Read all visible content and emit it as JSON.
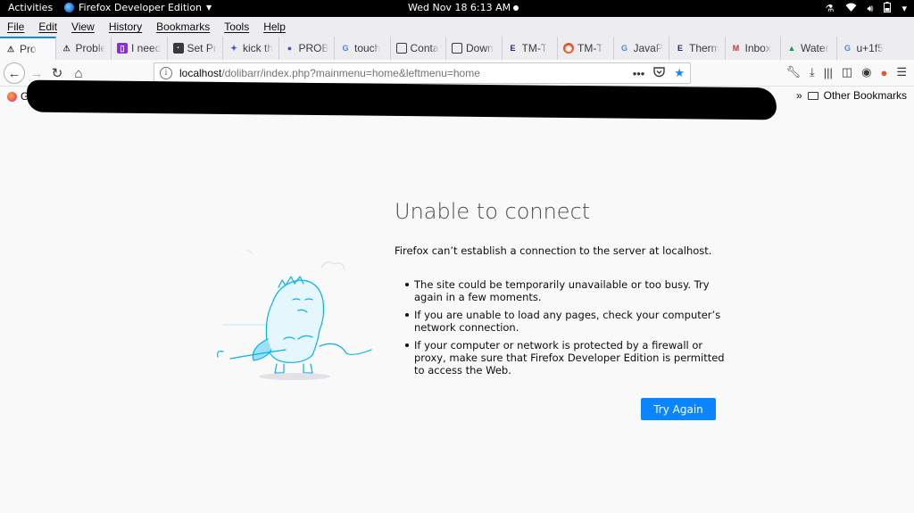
{
  "system_bar": {
    "activities": "Activities",
    "app_name": "Firefox Developer Edition",
    "clock": "Wed Nov 18   6:13 AM"
  },
  "menu": [
    "File",
    "Edit",
    "View",
    "History",
    "Bookmarks",
    "Tools",
    "Help"
  ],
  "tabs": [
    {
      "label": "Pro",
      "icon": "warning-icon",
      "active": true
    },
    {
      "label": "Proble",
      "icon": "warning-icon"
    },
    {
      "label": "I need",
      "icon": "purple-square-icon"
    },
    {
      "label": "Set Pr",
      "icon": "dark-square-icon"
    },
    {
      "label": "kick th",
      "icon": "kick-icon"
    },
    {
      "label": "PROB",
      "icon": "dots-icon"
    },
    {
      "label": "touch",
      "icon": "google-icon"
    },
    {
      "label": "Conta",
      "icon": "page-icon"
    },
    {
      "label": "Down",
      "icon": "page-icon"
    },
    {
      "label": "TM-T",
      "icon": "e-icon"
    },
    {
      "label": "TM-T",
      "icon": "duckduckgo-icon"
    },
    {
      "label": "JavaP",
      "icon": "google-icon"
    },
    {
      "label": "Therm",
      "icon": "e-icon"
    },
    {
      "label": "Inbox",
      "icon": "gmail-icon"
    },
    {
      "label": "Water",
      "icon": "drive-icon"
    },
    {
      "label": "u+1f5",
      "icon": "google-icon"
    }
  ],
  "url": {
    "host": "localhost",
    "path": "/dolibarr/index.php?mainmenu=home&leftmenu=home"
  },
  "bookmarks": {
    "first": "Get",
    "other": "Other Bookmarks"
  },
  "error": {
    "title": "Unable to connect",
    "description": "Firefox can’t establish a connection to the server at localhost.",
    "items": [
      "The site could be temporarily unavailable or too busy. Try again in a few moments.",
      "If you are unable to load any pages, check your computer’s network connection.",
      "If your computer or network is protected by a firewall or proxy, make sure that Firefox Developer Edition is permitted to access the Web."
    ],
    "button": "Try Again"
  },
  "colors": {
    "accent": "#0a84ff",
    "illustration": "#00b3f4"
  }
}
